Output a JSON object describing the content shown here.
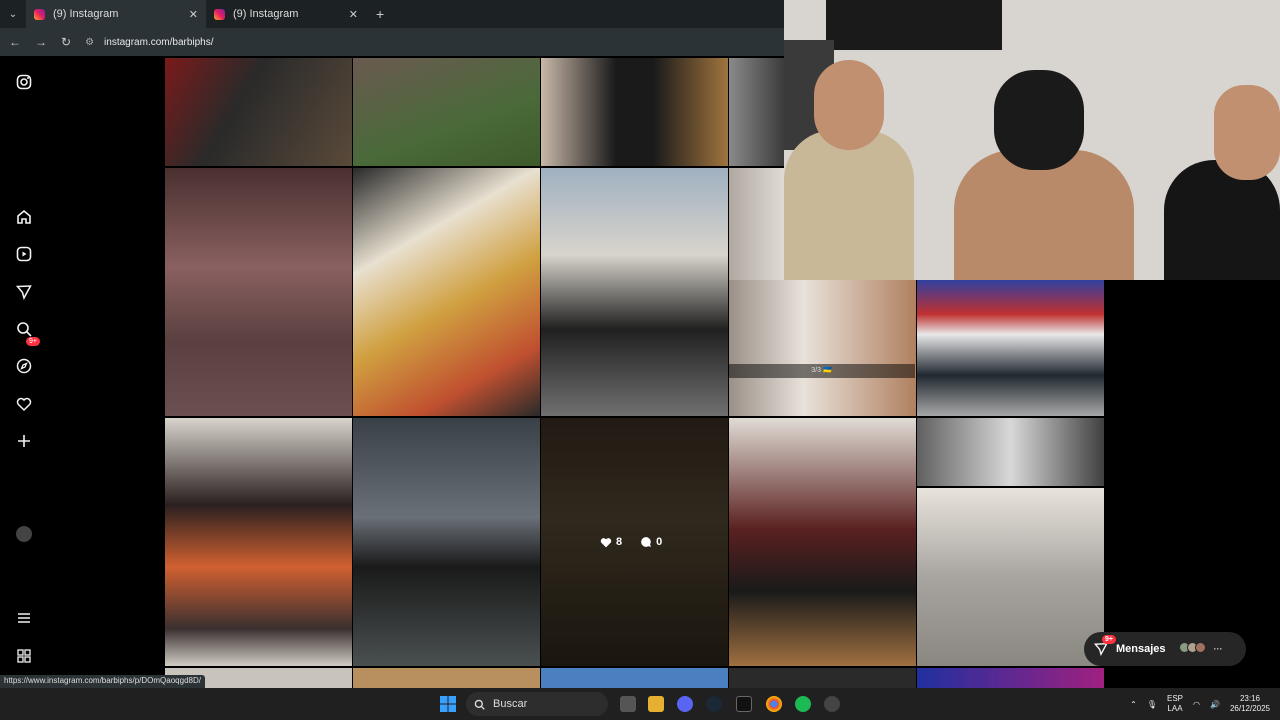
{
  "browser": {
    "tabs": [
      {
        "title": "(9) Instagram"
      },
      {
        "title": "(9) Instagram"
      }
    ],
    "address": "instagram.com/barbiphs/",
    "status_link": "https://www.instagram.com/barbiphs/p/DOmQaoqgd8D/"
  },
  "sidebar": {
    "notifications_badge": "9+"
  },
  "grid": {
    "hover_likes": "8",
    "hover_comments": "0",
    "carousel_caption": "3/3 🇺🇦"
  },
  "messages": {
    "label": "Mensajes",
    "badge": "9+"
  },
  "taskbar": {
    "search_placeholder": "Buscar",
    "lang_top": "ESP",
    "lang_bottom": "LAA",
    "time": "23:16",
    "date": "26/12/2025"
  },
  "colors": {
    "accent": "#ff3040",
    "tab_active": "#2b3336",
    "tab_bar": "#1c2224"
  }
}
